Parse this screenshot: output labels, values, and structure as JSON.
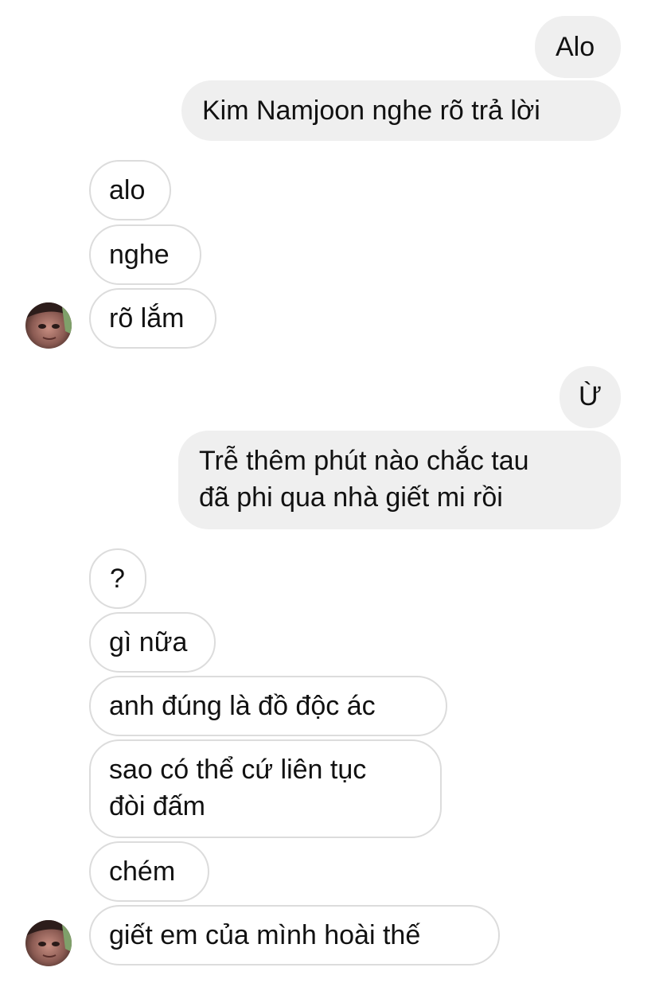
{
  "conversation": {
    "outgoing_1": "Alo",
    "outgoing_2": "Kim Namjoon nghe rõ trả lời",
    "incoming_1": "alo",
    "incoming_2": "nghe",
    "incoming_3": "rõ lắm",
    "outgoing_3": "Ừ",
    "outgoing_4_line1": "Trễ thêm phút nào chắc tau",
    "outgoing_4_line2": "đã phi qua nhà giết mi rồi",
    "incoming_4": "?",
    "incoming_5": "gì nữa",
    "incoming_6": "anh đúng là đồ độc ác",
    "incoming_7_line1": "sao có thể cứ liên tục",
    "incoming_7_line2": "đòi đấm",
    "incoming_8": "chém",
    "incoming_9": "giết em của mình hoài thế"
  },
  "colors": {
    "outgoing_bubble": "#efefef",
    "incoming_border": "#dcdcdc",
    "text": "#111111"
  }
}
